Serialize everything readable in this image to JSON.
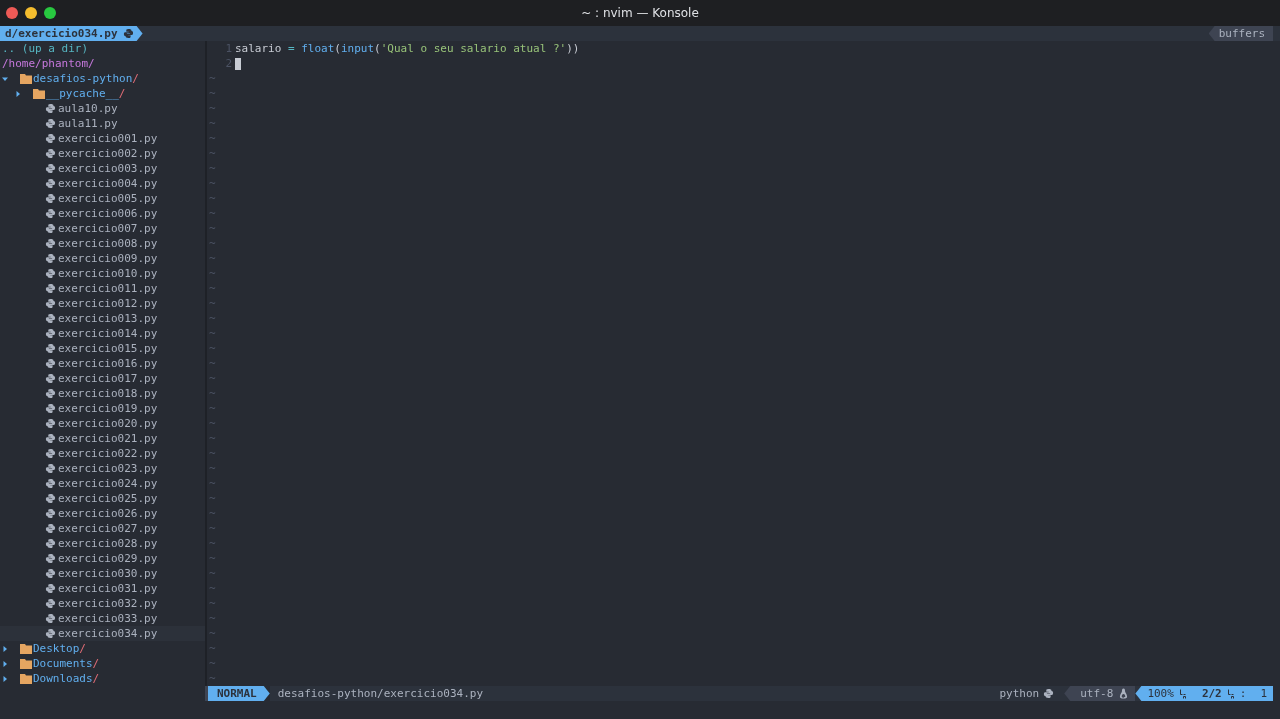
{
  "window": {
    "title": "~ : nvim — Konsole"
  },
  "tabline": {
    "tab": "d/exercicio034.py",
    "right_label": "buffers"
  },
  "tree": {
    "up": ".. (up a dir)",
    "root": "/home/phantom/",
    "nodes": [
      {
        "kind": "dir",
        "name": "desafios-python",
        "suffix": "/",
        "expanded": true,
        "children": [
          {
            "kind": "dir",
            "name": "__pycache__",
            "suffix": "/",
            "expanded": false
          },
          {
            "kind": "file",
            "name": "aula10.py",
            "selected": false
          },
          {
            "kind": "file",
            "name": "aula11.py",
            "selected": false
          },
          {
            "kind": "file",
            "name": "exercicio001.py",
            "selected": false
          },
          {
            "kind": "file",
            "name": "exercicio002.py",
            "selected": false
          },
          {
            "kind": "file",
            "name": "exercicio003.py",
            "selected": false
          },
          {
            "kind": "file",
            "name": "exercicio004.py",
            "selected": false
          },
          {
            "kind": "file",
            "name": "exercicio005.py",
            "selected": false
          },
          {
            "kind": "file",
            "name": "exercicio006.py",
            "selected": false
          },
          {
            "kind": "file",
            "name": "exercicio007.py",
            "selected": false
          },
          {
            "kind": "file",
            "name": "exercicio008.py",
            "selected": false
          },
          {
            "kind": "file",
            "name": "exercicio009.py",
            "selected": false
          },
          {
            "kind": "file",
            "name": "exercicio010.py",
            "selected": false
          },
          {
            "kind": "file",
            "name": "exercicio011.py",
            "selected": false
          },
          {
            "kind": "file",
            "name": "exercicio012.py",
            "selected": false
          },
          {
            "kind": "file",
            "name": "exercicio013.py",
            "selected": false
          },
          {
            "kind": "file",
            "name": "exercicio014.py",
            "selected": false
          },
          {
            "kind": "file",
            "name": "exercicio015.py",
            "selected": false
          },
          {
            "kind": "file",
            "name": "exercicio016.py",
            "selected": false
          },
          {
            "kind": "file",
            "name": "exercicio017.py",
            "selected": false
          },
          {
            "kind": "file",
            "name": "exercicio018.py",
            "selected": false
          },
          {
            "kind": "file",
            "name": "exercicio019.py",
            "selected": false
          },
          {
            "kind": "file",
            "name": "exercicio020.py",
            "selected": false
          },
          {
            "kind": "file",
            "name": "exercicio021.py",
            "selected": false
          },
          {
            "kind": "file",
            "name": "exercicio022.py",
            "selected": false
          },
          {
            "kind": "file",
            "name": "exercicio023.py",
            "selected": false
          },
          {
            "kind": "file",
            "name": "exercicio024.py",
            "selected": false
          },
          {
            "kind": "file",
            "name": "exercicio025.py",
            "selected": false
          },
          {
            "kind": "file",
            "name": "exercicio026.py",
            "selected": false
          },
          {
            "kind": "file",
            "name": "exercicio027.py",
            "selected": false
          },
          {
            "kind": "file",
            "name": "exercicio028.py",
            "selected": false
          },
          {
            "kind": "file",
            "name": "exercicio029.py",
            "selected": false
          },
          {
            "kind": "file",
            "name": "exercicio030.py",
            "selected": false
          },
          {
            "kind": "file",
            "name": "exercicio031.py",
            "selected": false
          },
          {
            "kind": "file",
            "name": "exercicio032.py",
            "selected": false
          },
          {
            "kind": "file",
            "name": "exercicio033.py",
            "selected": false
          },
          {
            "kind": "file",
            "name": "exercicio034.py",
            "selected": true
          }
        ]
      },
      {
        "kind": "dir",
        "name": "Desktop",
        "suffix": "/",
        "expanded": false
      },
      {
        "kind": "dir",
        "name": "Documents",
        "suffix": "/",
        "expanded": false
      },
      {
        "kind": "dir",
        "name": "Downloads",
        "suffix": "/",
        "expanded": false
      }
    ]
  },
  "editor": {
    "lines": [
      {
        "number": "1",
        "tokens": [
          {
            "kind": "ident",
            "text": "salario"
          },
          {
            "kind": "op",
            "text": " = "
          },
          {
            "kind": "func",
            "text": "float"
          },
          {
            "kind": "paren",
            "text": "("
          },
          {
            "kind": "func",
            "text": "input"
          },
          {
            "kind": "paren",
            "text": "("
          },
          {
            "kind": "string",
            "text": "'Qual o seu salario atual ?'"
          },
          {
            "kind": "paren",
            "text": "))"
          }
        ],
        "cursor": false
      },
      {
        "number": "2",
        "cursor": true
      }
    ],
    "tildes": [
      "~",
      "~",
      "~",
      "~",
      "~",
      "~",
      "~",
      "~",
      "~",
      "~",
      "~",
      "~",
      "~",
      "~",
      "~",
      "~",
      "~",
      "~",
      "~",
      "~",
      "~",
      "~",
      "~",
      "~",
      "~",
      "~",
      "~",
      "~",
      "~",
      "~",
      "~",
      "~",
      "~",
      "~",
      "~",
      "~",
      "~",
      "~",
      "~",
      "~",
      "~"
    ]
  },
  "status_bar": {
    "mode": "NORMAL",
    "file": "desafios-python/exercicio034.py",
    "filetype": "python",
    "encoding": "utf-8",
    "percent": "100%",
    "position": "2/2",
    "separator": ":",
    "column": "1"
  }
}
